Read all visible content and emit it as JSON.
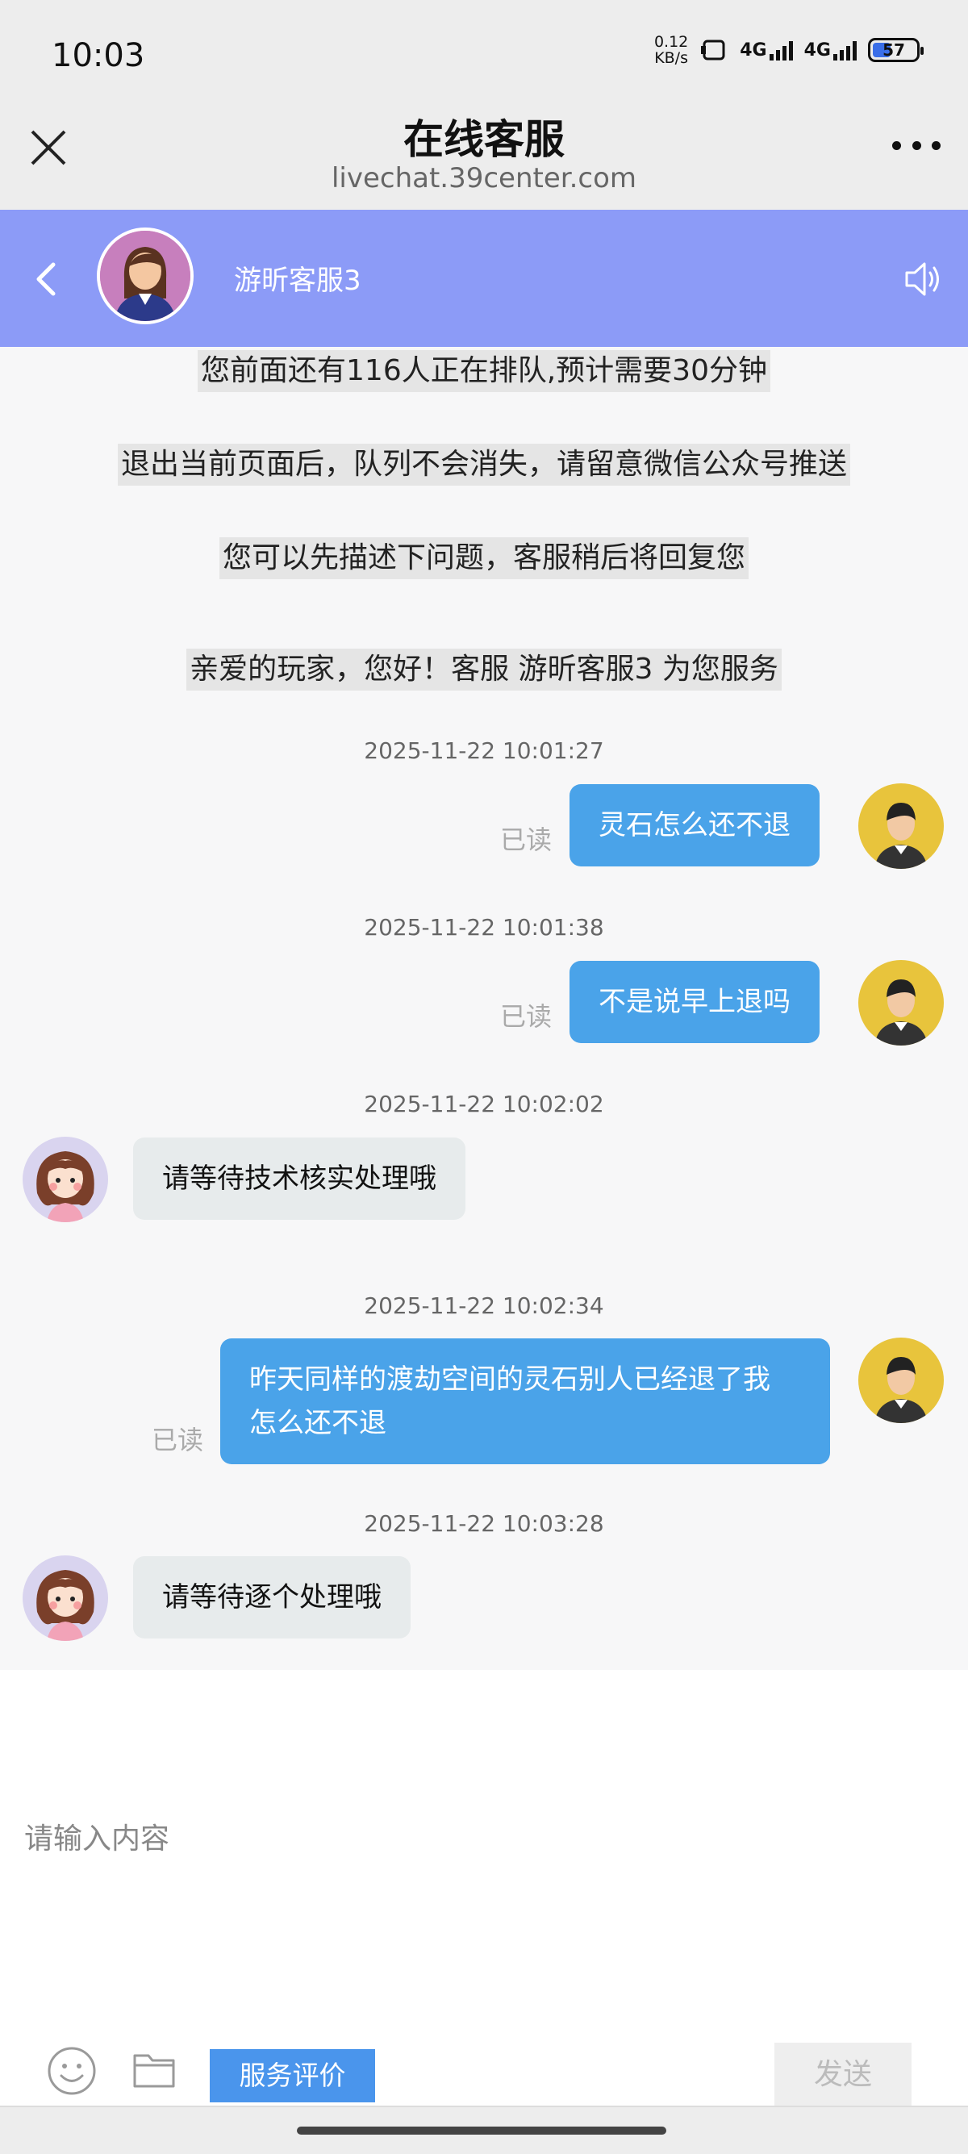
{
  "status": {
    "time": "10:03",
    "net_speed_value": "0.12",
    "net_speed_unit": "KB/s",
    "sig1_label": "4G",
    "sig2_label": "4G",
    "battery": "57"
  },
  "browser": {
    "title": "在线客服",
    "url": "livechat.39center.com"
  },
  "chat_header": {
    "agent_name": "游昕客服3"
  },
  "notices": [
    "您前面还有116人正在排队,预计需要30分钟",
    "退出当前页面后，队列不会消失，请留意微信公众号推送",
    "您可以先描述下问题，客服稍后将回复您",
    "亲爱的玩家，您好！客服 游昕客服3 为您服务"
  ],
  "messages": [
    {
      "time": "2025-11-22 10:01:27",
      "from": "me",
      "text": "灵石怎么还不退",
      "status": "已读"
    },
    {
      "time": "2025-11-22 10:01:38",
      "from": "me",
      "text": "不是说早上退吗",
      "status": "已读"
    },
    {
      "time": "2025-11-22 10:02:02",
      "from": "agent",
      "text": "请等待技术核实处理哦"
    },
    {
      "time": "2025-11-22 10:02:34",
      "from": "me",
      "text_line1": "昨天同样的渡劫空间的灵石别人已经退了我",
      "text_line2": "怎么还不退",
      "status": "已读"
    },
    {
      "time": "2025-11-22 10:03:28",
      "from": "agent",
      "text": "请等待逐个处理哦"
    }
  ],
  "composer": {
    "placeholder": "请输入内容",
    "rate_label": "服务评价",
    "send_label": "发送"
  },
  "colors": {
    "header_bg": "#8c9bf7",
    "my_bubble": "#4aa3e9",
    "agent_bubble": "#e7ebec",
    "rate_button": "#4a95ec"
  },
  "icons": [
    "close-icon",
    "more-icon",
    "back-icon",
    "speaker-icon",
    "emoji-icon",
    "folder-icon"
  ]
}
